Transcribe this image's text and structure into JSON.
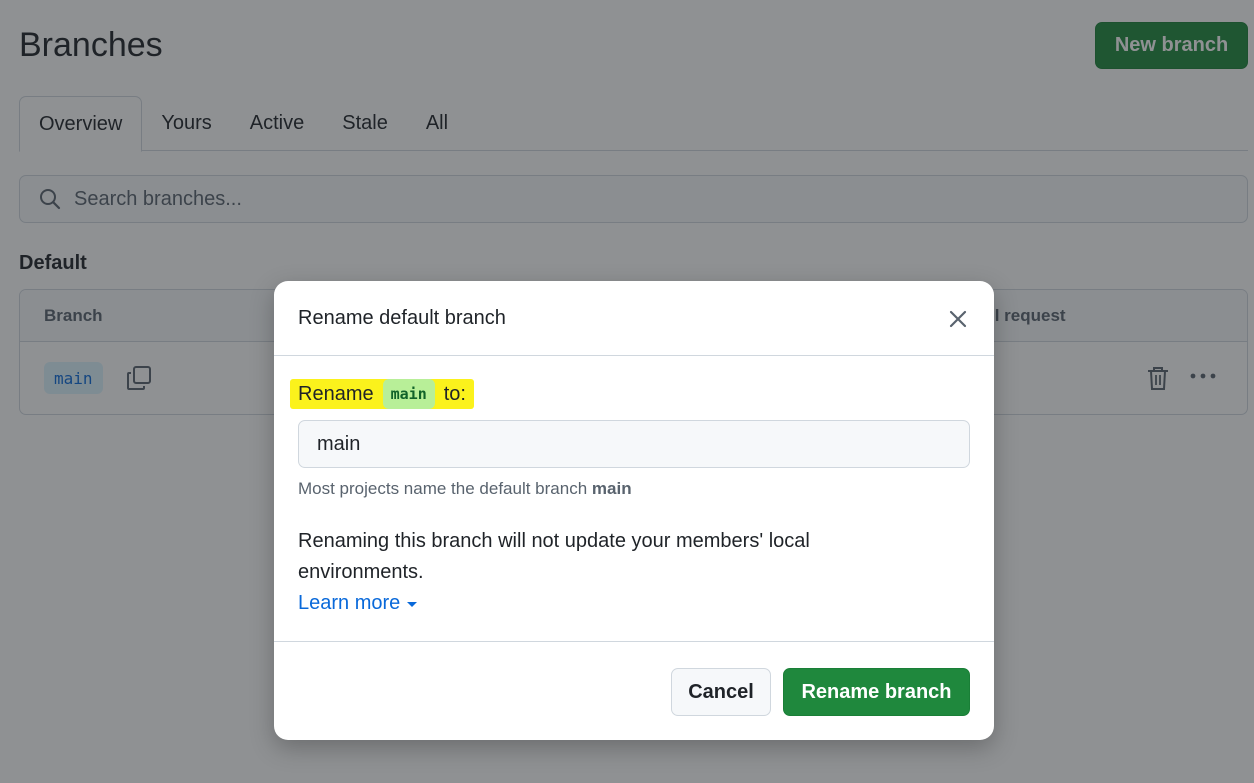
{
  "page": {
    "title": "Branches",
    "new_branch_label": "New branch"
  },
  "tabs": [
    {
      "label": "Overview",
      "active": true
    },
    {
      "label": "Yours",
      "active": false
    },
    {
      "label": "Active",
      "active": false
    },
    {
      "label": "Stale",
      "active": false
    },
    {
      "label": "All",
      "active": false
    }
  ],
  "search": {
    "placeholder": "Search branches..."
  },
  "default_section": {
    "title": "Default",
    "columns": {
      "branch": "Branch",
      "pull_request": "ll request"
    },
    "rows": [
      {
        "branch": "main"
      }
    ]
  },
  "dialog": {
    "title": "Rename default branch",
    "rename_prefix": "Rename",
    "rename_branch": "main",
    "rename_suffix": "to:",
    "input_value": "main",
    "hint_text": "Most projects name the default branch",
    "hint_branch": "main",
    "warning": "Renaming this branch will not update your members' local environments.",
    "learn_more": "Learn more",
    "cancel_label": "Cancel",
    "confirm_label": "Rename branch"
  },
  "colors": {
    "primary_green": "#1f883d",
    "link_blue": "#0969da",
    "highlight_yellow": "#fbf21c"
  },
  "icons": {
    "search": "search-icon",
    "copy": "copy-icon",
    "trash": "trash-icon",
    "more": "kebab-horizontal-icon",
    "close": "close-icon",
    "caret": "caret-down-icon"
  }
}
